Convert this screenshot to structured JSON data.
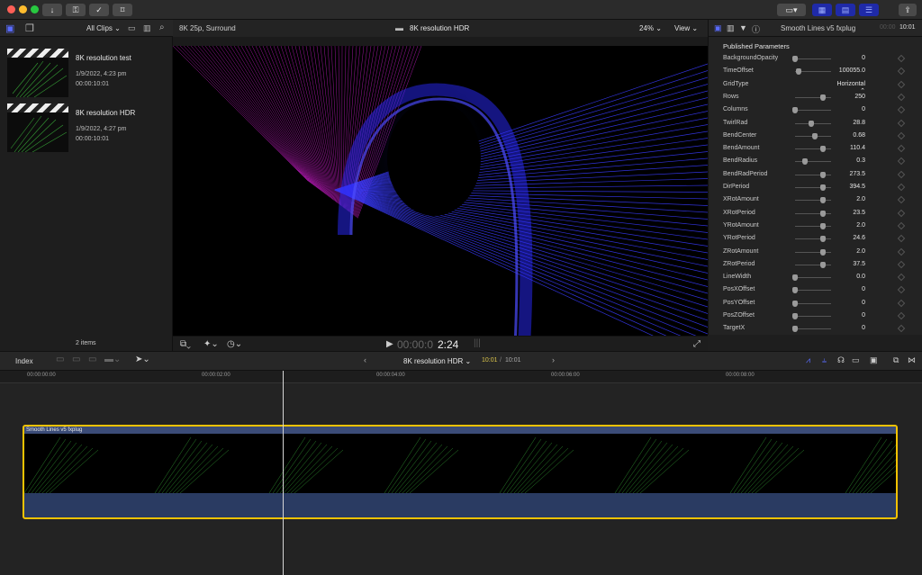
{
  "toolbar": {
    "import_icon": "download-icon",
    "keywords_icon": "key-icon",
    "background_tasks_icon": "checkmark-circle-icon",
    "tags_icon": "tag-icon",
    "share_icon": "share-icon"
  },
  "browser": {
    "filter_label": "All Clips",
    "clips": [
      {
        "name": "8K resolution test",
        "date": "1/9/2022, 4:23 pm",
        "duration": "00:00:10:01"
      },
      {
        "name": "8K resolution HDR",
        "date": "1/9/2022, 4:27 pm",
        "duration": "00:00:10:01"
      }
    ],
    "item_count": "2 items"
  },
  "viewer": {
    "format": "8K 25p, Surround",
    "clip_name": "8K resolution HDR",
    "zoom": "24%",
    "view_label": "View",
    "timecode_dim": "00:00:0",
    "timecode_bright": "2:24"
  },
  "inspector": {
    "title": "Smooth Lines v5 fxplug",
    "time_dim": "00:00",
    "time_bright": "10:01",
    "section": "Published Parameters",
    "params": [
      {
        "name": "BackgroundOpacity",
        "value": "0",
        "pos": 0
      },
      {
        "name": "TimeOffset",
        "value": "100055.0",
        "pos": 0.12
      },
      {
        "name": "GridType",
        "value": "Horizontal ⌃",
        "pos": -1
      },
      {
        "name": "Rows",
        "value": "250",
        "pos": 0.85
      },
      {
        "name": "Columns",
        "value": "0",
        "pos": 0
      },
      {
        "name": "TwirlRad",
        "value": "28.8",
        "pos": 0.5
      },
      {
        "name": "BendCenter",
        "value": "0.68",
        "pos": 0.6
      },
      {
        "name": "BendAmount",
        "value": "110.4",
        "pos": 0.85
      },
      {
        "name": "BendRadius",
        "value": "0.3",
        "pos": 0.3
      },
      {
        "name": "BendRadPeriod",
        "value": "273.5",
        "pos": 0.85
      },
      {
        "name": "DirPeriod",
        "value": "394.5",
        "pos": 0.85
      },
      {
        "name": "XRotAmount",
        "value": "2.0",
        "pos": 0.85
      },
      {
        "name": "XRotPeriod",
        "value": "23.5",
        "pos": 0.85
      },
      {
        "name": "YRotAmount",
        "value": "2.0",
        "pos": 0.85
      },
      {
        "name": "YRotPeriod",
        "value": "24.6",
        "pos": 0.85
      },
      {
        "name": "ZRotAmount",
        "value": "2.0",
        "pos": 0.85
      },
      {
        "name": "ZRotPeriod",
        "value": "37.5",
        "pos": 0.85
      },
      {
        "name": "LineWidth",
        "value": "0.0",
        "pos": 0
      },
      {
        "name": "PosXOffset",
        "value": "0",
        "pos": 0
      },
      {
        "name": "PosYOffset",
        "value": "0",
        "pos": 0
      },
      {
        "name": "PosZOffset",
        "value": "0",
        "pos": 0
      },
      {
        "name": "TargetX",
        "value": "0",
        "pos": 0
      }
    ]
  },
  "timeline": {
    "index_label": "Index",
    "project_name": "8K resolution HDR",
    "position": "10:01",
    "duration": "10:01",
    "ruler": [
      "00:00:00:00",
      "00:00:02:00",
      "00:00:04:00",
      "00:00:06:00",
      "00:00:08:00"
    ],
    "clip_title": "Smooth Lines v5 fxplug"
  },
  "colors": {
    "accent": "#2f3dc8",
    "selection": "#f2c200",
    "clip_blue": "#2a3b62"
  }
}
